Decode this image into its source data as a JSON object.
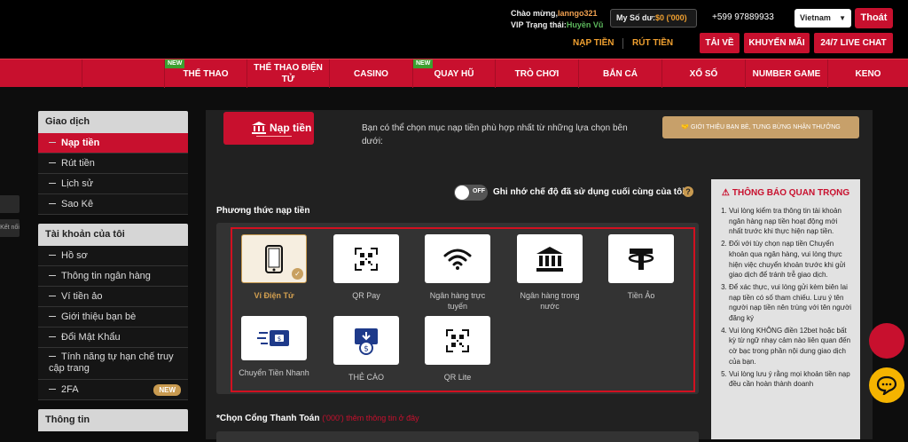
{
  "header": {
    "greeting_label": "Chào mừng,",
    "username": "lanngo321",
    "vip_label": "VIP Trạng thái:",
    "vip_status": "Huyền Vũ",
    "balance_label": "My Số dư:",
    "balance_value": "$0 ('000)",
    "phone": "+599 97889933",
    "language": "Vietnam",
    "logout": "Thoát",
    "deposit_link": "NẠP TIỀN",
    "withdraw_link": "RÚT TIỀN",
    "download": "TẢI VỀ",
    "promotions": "KHUYẾN MÃI",
    "live_chat": "24/7 LIVE CHAT"
  },
  "nav": {
    "items": [
      {
        "label": "THỂ THAO",
        "badge": "NEW"
      },
      {
        "label": "THỂ THAO ĐIỆN TỬ"
      },
      {
        "label": "CASINO"
      },
      {
        "label": "QUAY HŨ",
        "badge": "NEW"
      },
      {
        "label": "TRÒ CHƠI"
      },
      {
        "label": "BẮN CÁ"
      },
      {
        "label": "XỔ SỐ"
      },
      {
        "label": "NUMBER GAME"
      },
      {
        "label": "KENO"
      }
    ]
  },
  "edge": {
    "tab2": "Kết nối"
  },
  "sidebar": {
    "transactions": {
      "title": "Giao dịch",
      "items": [
        "Nạp tiền",
        "Rút tiền",
        "Lịch sử",
        "Sao Kê"
      ]
    },
    "account": {
      "title": "Tài khoản của tôi",
      "items": [
        "Hồ sơ",
        "Thông tin ngân hàng",
        "Ví tiền ảo",
        "Giới thiệu bạn bè",
        "Đổi Mật Khẩu",
        "Tính năng tự hạn chế truy cập trang",
        "2FA"
      ],
      "badge_2fa": "NEW"
    },
    "info": {
      "title": "Thông tin"
    }
  },
  "main": {
    "deposit_title": "Nạp tiền",
    "intro": "Bạn có thể chọn mục nạp tiền phù hợp nhất từ những lựa chọn bên dưới:",
    "referral": "GIỚI THIỆU BẠN BÈ, TƯNG BỪNG NHẬN THƯỞNG",
    "toggle_state": "OFF",
    "remember_label": "Ghi nhớ chế độ đã sử dụng cuối cùng của tôi",
    "methods_label": "Phương thức nạp tiền",
    "methods": [
      {
        "label": "Ví Điện Tử",
        "icon": "phone-icon",
        "selected": true
      },
      {
        "label": "QR Pay",
        "icon": "qr-code-icon"
      },
      {
        "label": "Ngân hàng trực tuyến",
        "icon": "wifi-icon"
      },
      {
        "label": "Ngân hàng trong nước",
        "icon": "bank-icon"
      },
      {
        "label": "Tiền Ảo",
        "icon": "tether-icon"
      },
      {
        "label": "Chuyển Tiền Nhanh",
        "icon": "fast-transfer-icon"
      },
      {
        "label": "THẺ CÀO",
        "icon": "scratch-card-icon"
      },
      {
        "label": "QR Lite",
        "icon": "qr-code-icon"
      }
    ],
    "gateway_label": "*Chọn Cổng Thanh Toán",
    "gateway_hint": "('000') thêm thông tin ở đây"
  },
  "notice": {
    "title": "THÔNG BÁO QUAN TRỌNG",
    "items": [
      "Vui lòng kiểm tra thông tin tài khoản ngân hàng nạp tiền hoạt động mới nhất trước khi thực hiện nạp tiền.",
      "Đối với tùy chọn nạp tiền Chuyển khoản qua ngân hàng, vui lòng thực hiện việc chuyển khoản trước khi gửi giao dịch để tránh trễ giao dịch.",
      "Để xác thực, vui lòng gửi kèm biên lai nạp tiền có số tham chiếu. Lưu ý tên người nạp tiền nên trùng với tên người đăng ký",
      "Vui lòng KHÔNG điền 12bet hoặc bất kỳ từ ngữ nhạy cảm nào liên quan đến cờ bạc trong phần nội dung giao dịch của bạn.",
      "Vui lòng lưu ý rằng mọi khoản tiền nạp đều cần hoàn thành doanh"
    ]
  },
  "colors": {
    "brand_red": "#c8102e",
    "gold": "#c89a50",
    "new_green": "#3ca030"
  }
}
